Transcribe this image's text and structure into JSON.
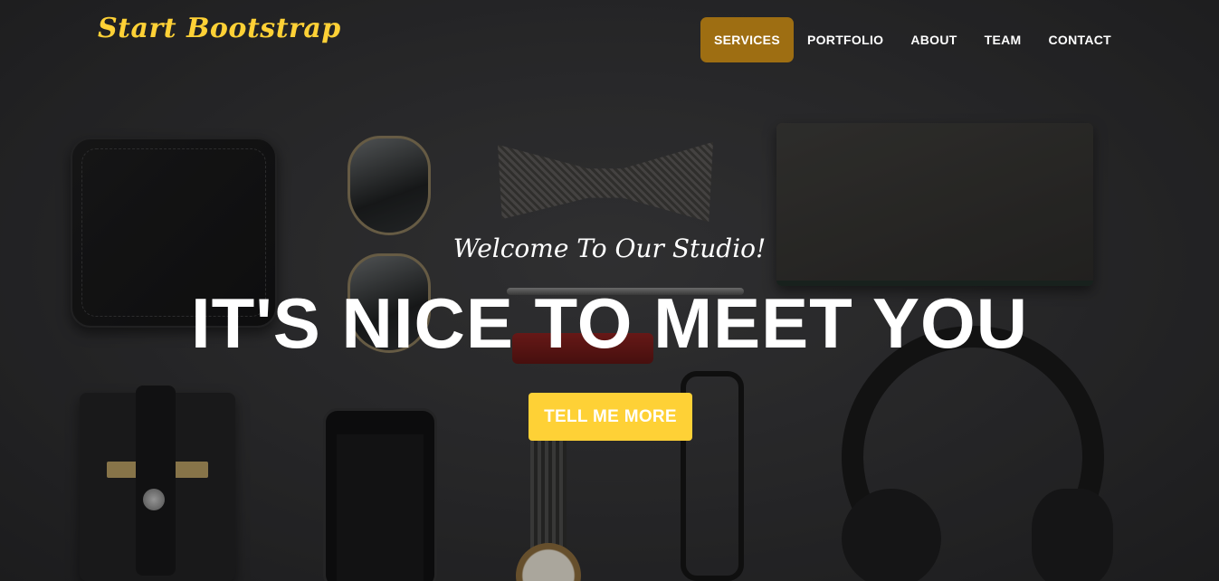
{
  "brand": {
    "name": "Start Bootstrap"
  },
  "nav": {
    "items": [
      {
        "label": "SERVICES",
        "active": true
      },
      {
        "label": "PORTFOLIO",
        "active": false
      },
      {
        "label": "ABOUT",
        "active": false
      },
      {
        "label": "TEAM",
        "active": false
      },
      {
        "label": "CONTACT",
        "active": false
      }
    ]
  },
  "hero": {
    "lead_in": "Welcome To Our Studio!",
    "heading": "IT'S NICE TO MEET YOU",
    "cta_label": "TELL ME MORE"
  },
  "colors": {
    "accent": "#fed136",
    "nav_active": "#9e6e12",
    "background": "#2b2b2d"
  },
  "icons": {
    "background_image": "flat-lay-accessories-photo"
  }
}
